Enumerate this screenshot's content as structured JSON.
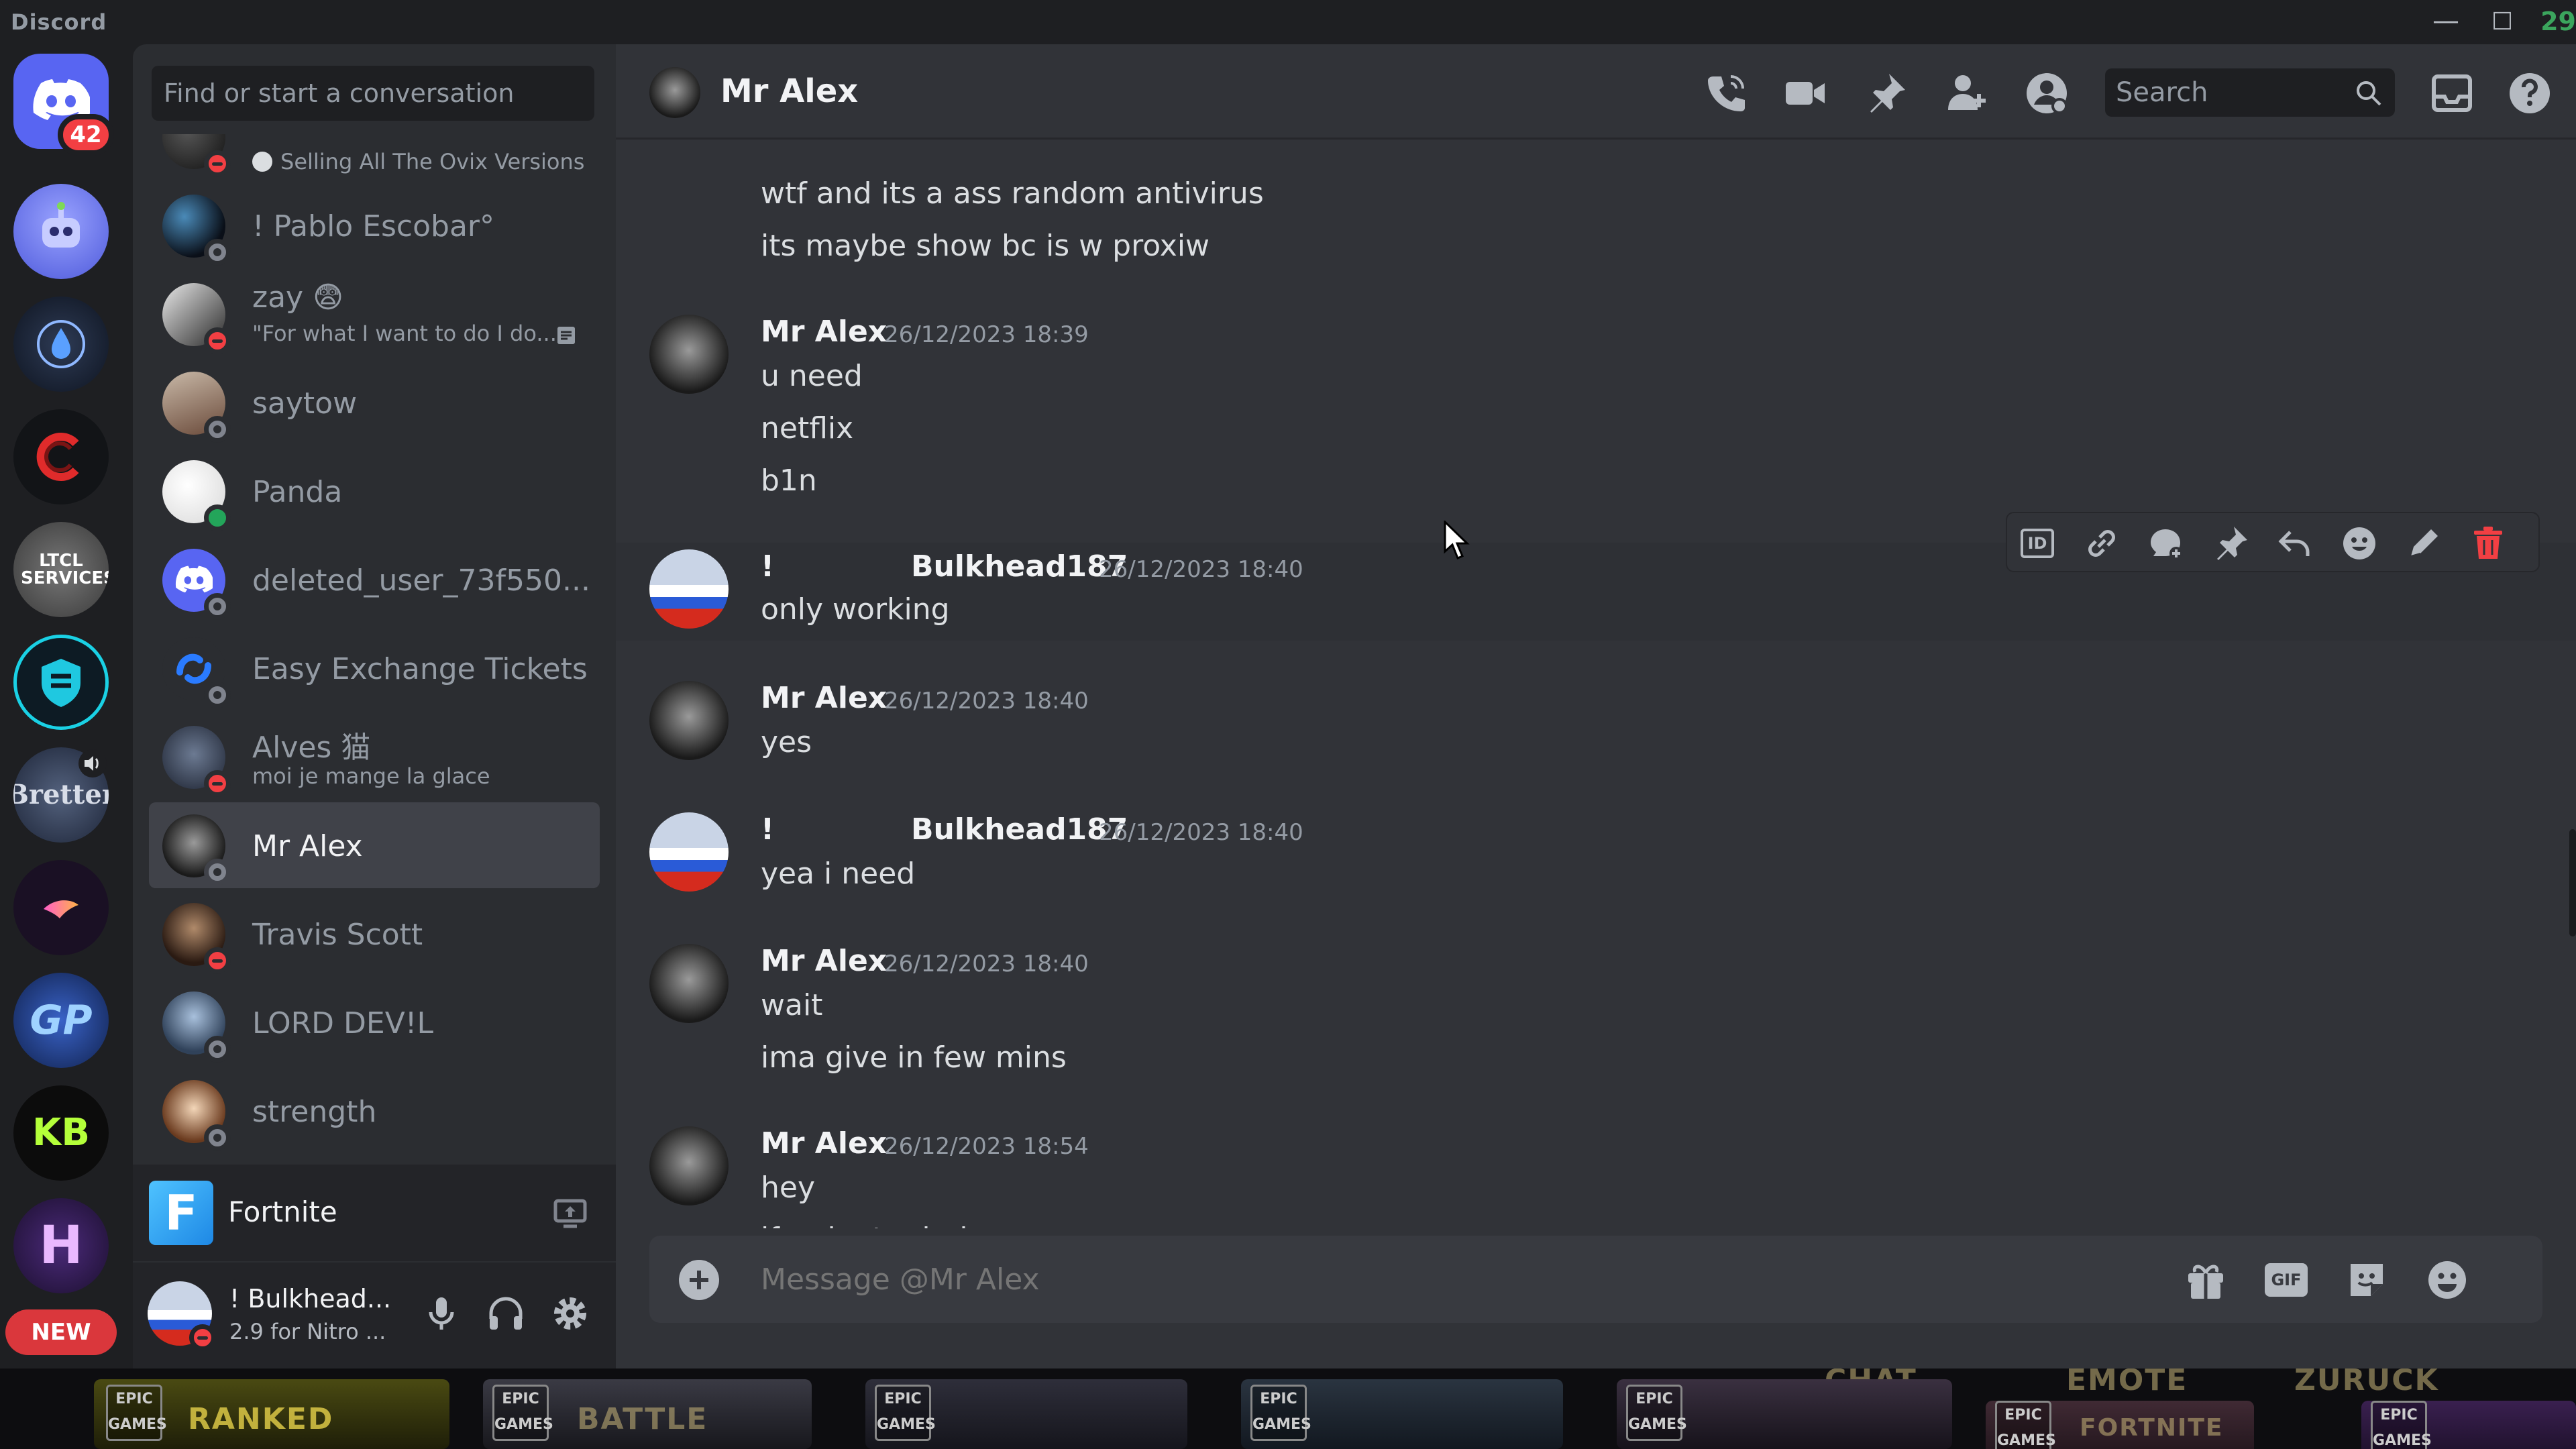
{
  "titlebar": {
    "app_name": "Discord",
    "minimize": "—",
    "maximize": "☐",
    "clock": "29"
  },
  "servers": {
    "home_badge": "42",
    "ltcl_label": "LTCL SERVICES",
    "bretter_label": "Bretter",
    "gp_label": "GP",
    "kb_label": "KB",
    "h_label": "H",
    "new_pill": "NEW"
  },
  "dm_sidebar": {
    "search_placeholder": "Find or start a conversation",
    "items": [
      {
        "name": "",
        "sub": "Selling All The Ovix Versions",
        "status": "dnd"
      },
      {
        "name": "! Pablo Escobar°",
        "sub": "",
        "status": "offline"
      },
      {
        "name": "zay 😨",
        "sub": "\"For what I want to do I do...",
        "status": "dnd"
      },
      {
        "name": "saytow",
        "sub": "",
        "status": "offline"
      },
      {
        "name": "Panda",
        "sub": "",
        "status": "online"
      },
      {
        "name": "deleted_user_73f550...",
        "sub": "",
        "status": "offline"
      },
      {
        "name": "Easy Exchange Tickets",
        "sub": "",
        "status": "offline"
      },
      {
        "name": "Alves 猫",
        "sub": "moi je mange la glace",
        "status": "dnd"
      },
      {
        "name": "Mr Alex",
        "sub": "",
        "status": "offline"
      },
      {
        "name": "Travis Scott",
        "sub": "",
        "status": "dnd"
      },
      {
        "name": "LORD DEV!L",
        "sub": "",
        "status": "offline"
      },
      {
        "name": "strength",
        "sub": "",
        "status": "offline"
      }
    ],
    "activity": {
      "icon_letter": "F",
      "name": "Fortnite"
    },
    "user": {
      "name": "! Bulkhead...",
      "status": "2.9 for Nitro ..."
    }
  },
  "chat": {
    "header_title": "Mr Alex",
    "search_placeholder": "Search",
    "messages": {
      "pre_1": "wtf and its a ass random antivirus",
      "pre_2": "its maybe show bc is w proxiw",
      "g1_author": "Mr Alex",
      "g1_time": "26/12/2023 18:39",
      "g1_l1": "u need",
      "g1_l2": "netflix",
      "g1_l3": "b1n",
      "g2_prefix": "!",
      "g2_author": "Bulkhead187",
      "g2_time": "26/12/2023 18:40",
      "g2_l1": "only working",
      "g3_author": "Mr Alex",
      "g3_time": "26/12/2023 18:40",
      "g3_l1": "yes",
      "g4_prefix": "!",
      "g4_author": "Bulkhead187",
      "g4_time": "26/12/2023 18:40",
      "g4_l1": "yea i need",
      "g5_author": "Mr Alex",
      "g5_time": "26/12/2023 18:40",
      "g5_l1": "wait",
      "g5_l2": "ima give in few mins",
      "g6_author": "Mr Alex",
      "g6_time": "26/12/2023 18:54",
      "g6_l1": "hey",
      "g6_l2": "if u dont mind"
    },
    "composer_placeholder": "Message @Mr Alex",
    "gif_label": "GIF",
    "id_label": "ID"
  },
  "taskbar": {
    "epic_label": "EPIC GAMES",
    "banner_1": "RANKED",
    "banner_2": "BATTLE",
    "banner_3": "CHAT",
    "banner_4": "EMOTE",
    "banner_5": "ZURÜCK",
    "banner_6": "FORTNITE"
  },
  "colors": {
    "blurple": "#5865f2",
    "red": "#f23f43",
    "green": "#23a55a",
    "bg_chat": "#313338"
  }
}
